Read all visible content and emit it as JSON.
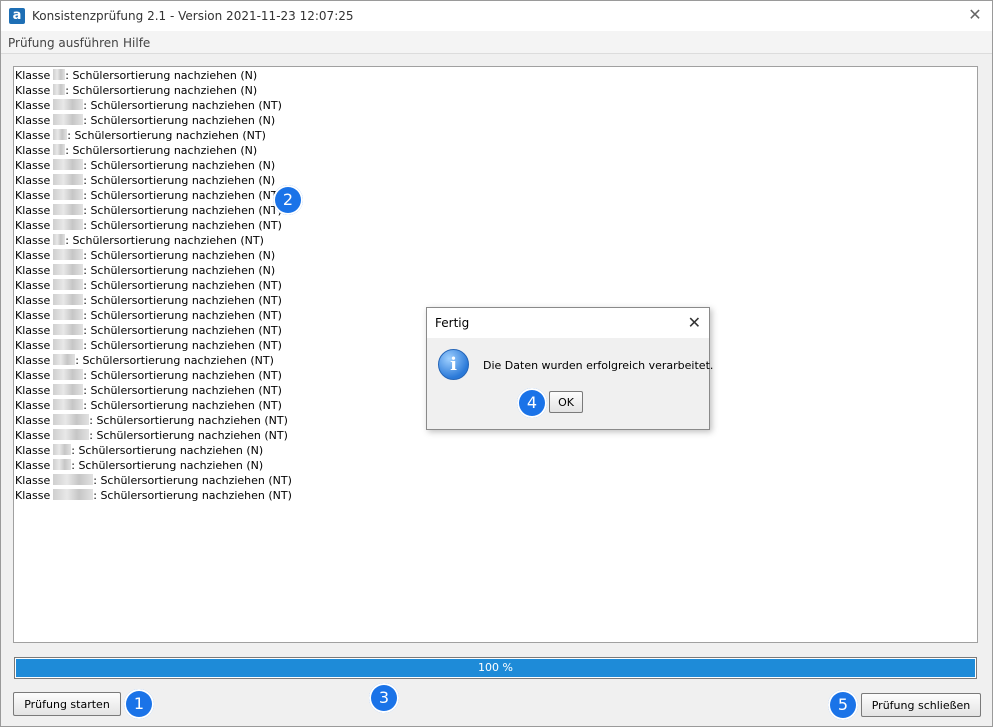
{
  "window": {
    "title": "Konsistenzprüfung 2.1 - Version 2021-11-23 12:07:25",
    "app_icon_glyph": "a"
  },
  "menu": {
    "items": [
      "Prüfung ausführen",
      "Hilfe"
    ]
  },
  "log": {
    "lines": [
      {
        "prefix": "Klasse",
        "mask": 12,
        "text": ": Schülersortierung nachziehen (N)"
      },
      {
        "prefix": "Klasse",
        "mask": 12,
        "text": ": Schülersortierung nachziehen (N)"
      },
      {
        "prefix": "Klasse",
        "mask": 30,
        "text": ": Schülersortierung nachziehen (NT)"
      },
      {
        "prefix": "Klasse",
        "mask": 30,
        "text": ": Schülersortierung nachziehen (N)"
      },
      {
        "prefix": "Klasse",
        "mask": 14,
        "text": ": Schülersortierung nachziehen (NT)"
      },
      {
        "prefix": "Klasse",
        "mask": 12,
        "text": ": Schülersortierung nachziehen (N)"
      },
      {
        "prefix": "Klasse",
        "mask": 30,
        "text": ": Schülersortierung nachziehen (N)"
      },
      {
        "prefix": "Klasse",
        "mask": 30,
        "text": ": Schülersortierung nachziehen (N)"
      },
      {
        "prefix": "Klasse",
        "mask": 30,
        "text": ": Schülersortierung nachziehen (NT)"
      },
      {
        "prefix": "Klasse",
        "mask": 30,
        "text": ": Schülersortierung nachziehen (NT)"
      },
      {
        "prefix": "Klasse",
        "mask": 30,
        "text": ": Schülersortierung nachziehen (NT)"
      },
      {
        "prefix": "Klasse",
        "mask": 12,
        "text": ": Schülersortierung nachziehen (NT)"
      },
      {
        "prefix": "Klasse",
        "mask": 30,
        "text": ": Schülersortierung nachziehen (N)"
      },
      {
        "prefix": "Klasse",
        "mask": 30,
        "text": ": Schülersortierung nachziehen (N)"
      },
      {
        "prefix": "Klasse",
        "mask": 30,
        "text": ": Schülersortierung nachziehen (NT)"
      },
      {
        "prefix": "Klasse",
        "mask": 30,
        "text": ": Schülersortierung nachziehen (NT)"
      },
      {
        "prefix": "Klasse",
        "mask": 30,
        "text": ": Schülersortierung nachziehen (NT)"
      },
      {
        "prefix": "Klasse",
        "mask": 30,
        "text": ": Schülersortierung nachziehen (NT)"
      },
      {
        "prefix": "Klasse",
        "mask": 30,
        "text": ": Schülersortierung nachziehen (NT)"
      },
      {
        "prefix": "Klasse",
        "mask": 22,
        "text": ": Schülersortierung nachziehen (NT)"
      },
      {
        "prefix": "Klasse",
        "mask": 30,
        "text": ": Schülersortierung nachziehen (NT)"
      },
      {
        "prefix": "Klasse",
        "mask": 30,
        "text": ": Schülersortierung nachziehen (NT)"
      },
      {
        "prefix": "Klasse",
        "mask": 30,
        "text": ": Schülersortierung nachziehen (NT)"
      },
      {
        "prefix": "Klasse",
        "mask": 36,
        "text": ": Schülersortierung nachziehen (NT)"
      },
      {
        "prefix": "Klasse",
        "mask": 36,
        "text": ": Schülersortierung nachziehen (NT)"
      },
      {
        "prefix": "Klasse",
        "mask": 18,
        "text": ": Schülersortierung nachziehen (N)"
      },
      {
        "prefix": "Klasse",
        "mask": 18,
        "text": ": Schülersortierung nachziehen (N)"
      },
      {
        "prefix": "Klasse",
        "mask": 40,
        "text": ": Schülersortierung nachziehen (NT)"
      },
      {
        "prefix": "Klasse",
        "mask": 40,
        "text": ": Schülersortierung nachziehen (NT)"
      }
    ]
  },
  "progress": {
    "percent": 100,
    "label": "100 %",
    "color": "#1e8bd8"
  },
  "buttons": {
    "start": "Prüfung starten",
    "close": "Prüfung schließen"
  },
  "dialog": {
    "title": "Fertig",
    "message": "Die Daten wurden erfolgreich verarbeitet.",
    "ok": "OK",
    "icon": "info-icon"
  },
  "badges": [
    "1",
    "2",
    "3",
    "4",
    "5"
  ]
}
